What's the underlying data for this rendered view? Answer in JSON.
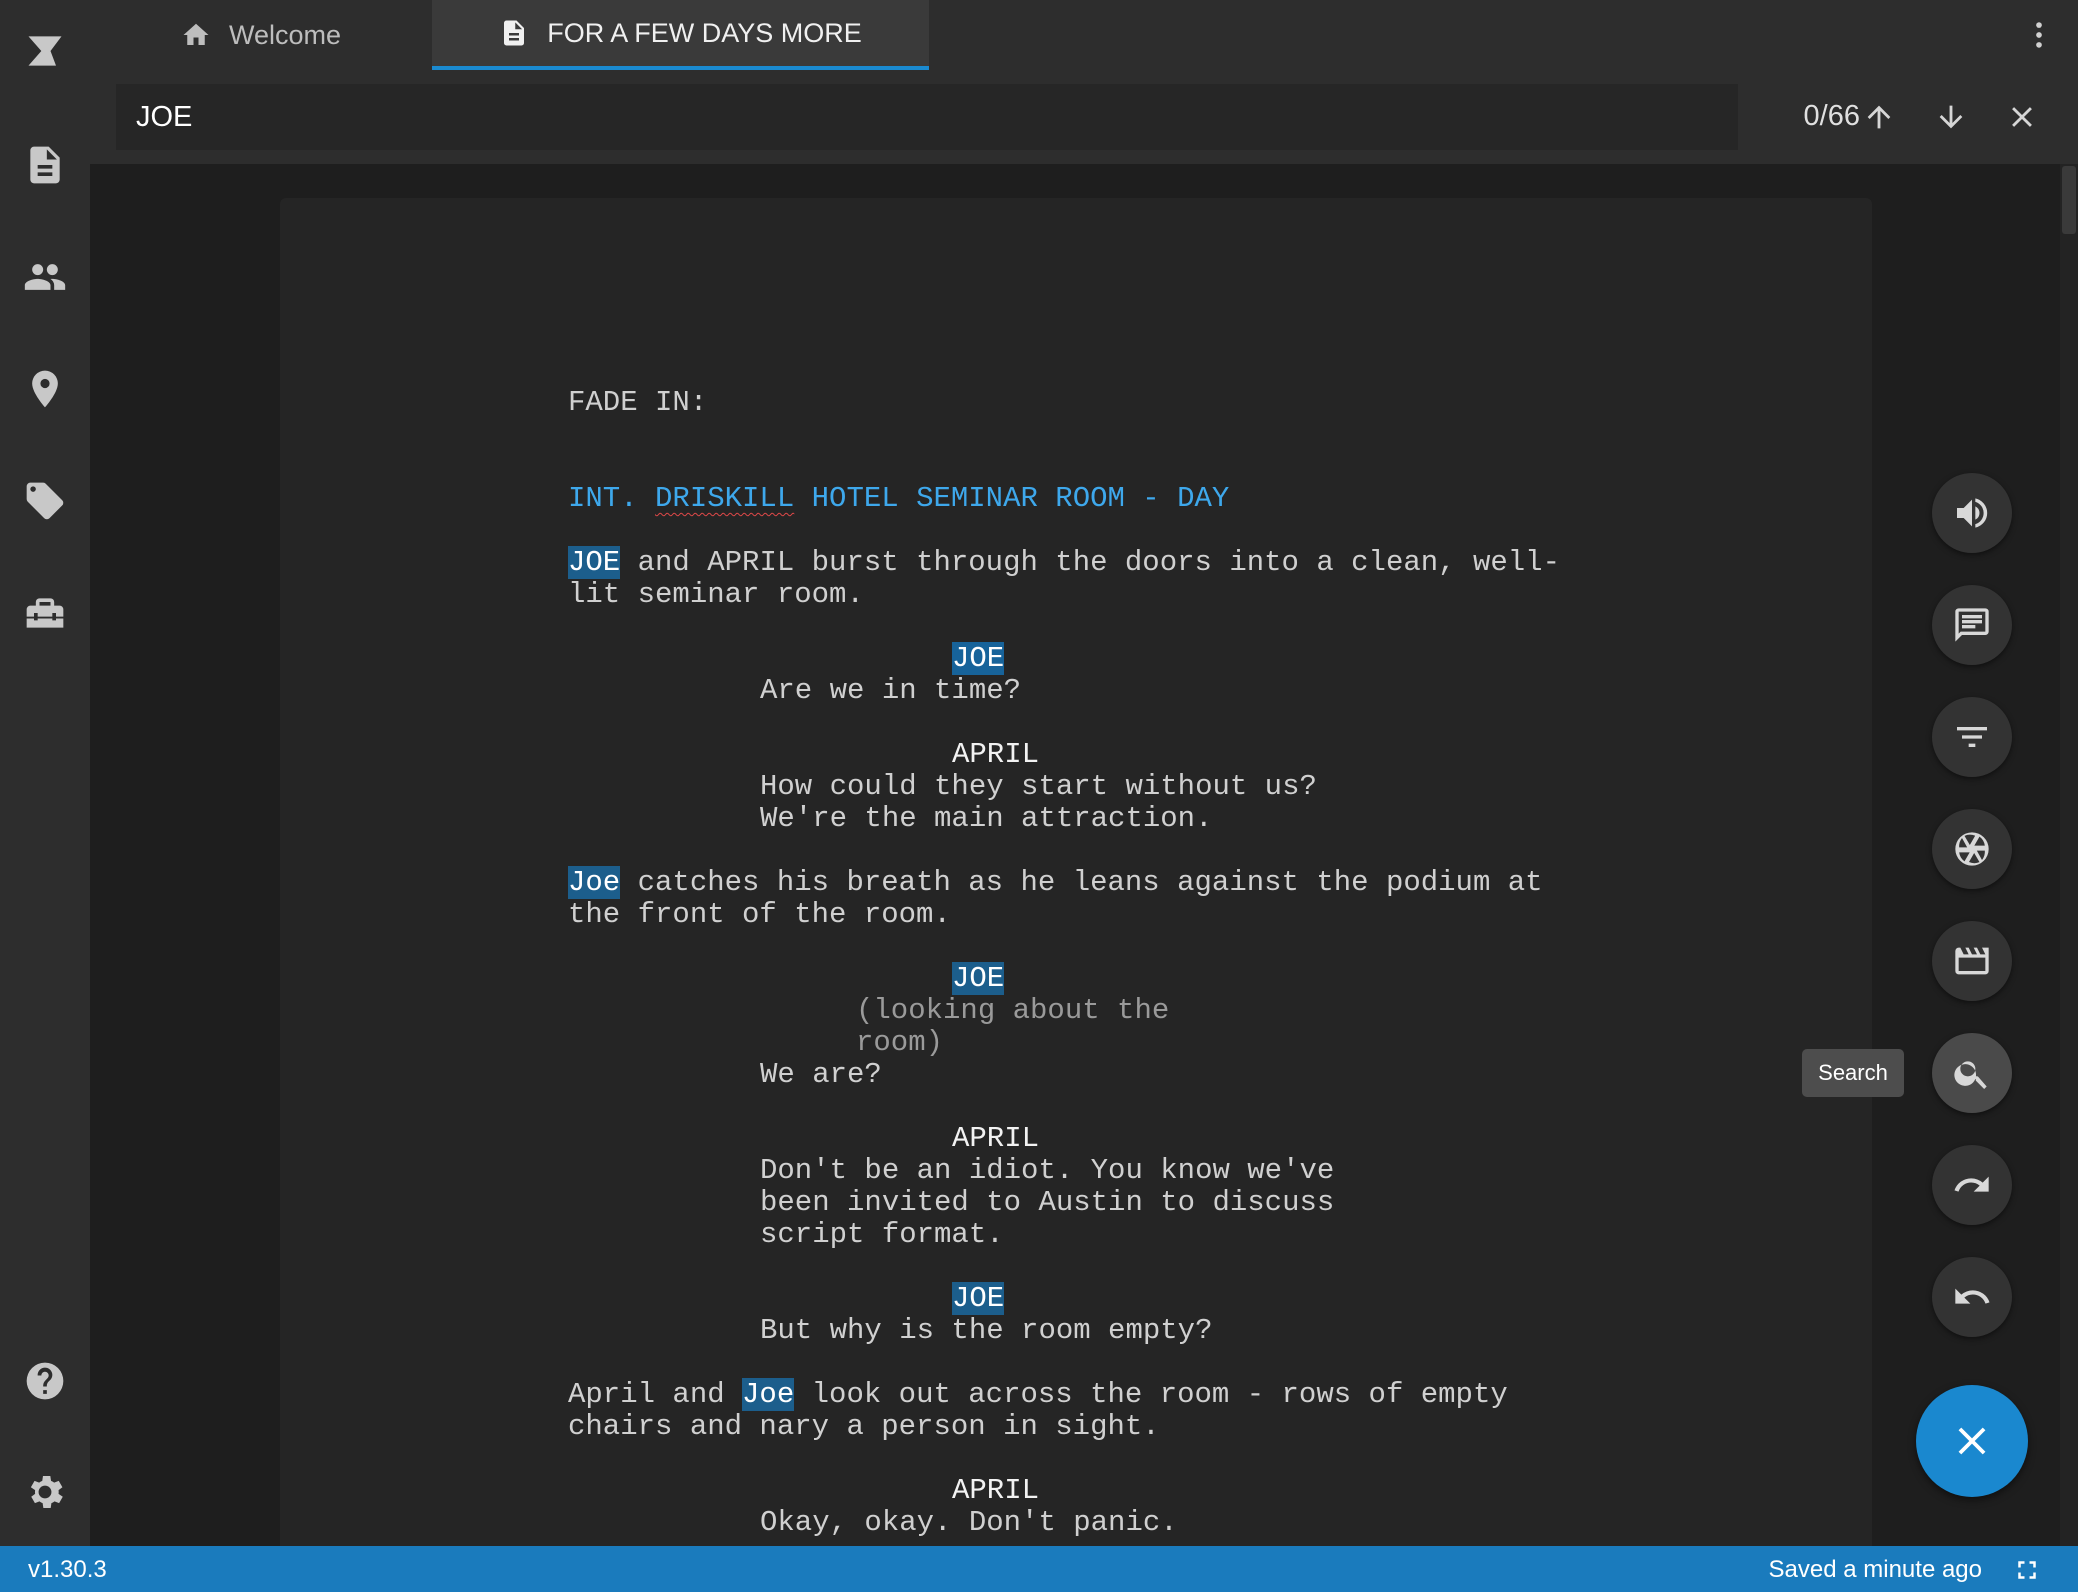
{
  "tabs": [
    {
      "label": "Welcome",
      "icon": "home-icon"
    },
    {
      "label": "FOR A FEW DAYS MORE",
      "icon": "document-icon",
      "active": true
    }
  ],
  "sidebar": {
    "items": [
      "logo-icon",
      "document-icon",
      "people-icon",
      "location-pin-icon",
      "tag-icon",
      "toolbox-icon"
    ],
    "bottom": [
      "help-icon",
      "gear-icon"
    ]
  },
  "search": {
    "value": "JOE",
    "count": "0/66"
  },
  "script": {
    "lines": [
      {
        "text": "FADE IN:"
      },
      {
        "seg": [
          "INT. ",
          "DRISKILL",
          " HOTEL SEMINAR ROOM - DAY"
        ]
      },
      {
        "seg": [
          "JOE",
          " and APRIL burst through the doors into a clean, well-"
        ]
      },
      {
        "text": "lit seminar room."
      },
      {
        "text": "JOE"
      },
      {
        "text": "Are we in time?"
      },
      {
        "text": "APRIL"
      },
      {
        "text": "How could they start without us?"
      },
      {
        "text": "We're the main attraction."
      },
      {
        "seg": [
          "Joe",
          " catches his breath as he leans against the podium at"
        ]
      },
      {
        "text": "the front of the room."
      },
      {
        "text": "JOE"
      },
      {
        "text": "(looking about the"
      },
      {
        "text": "room)"
      },
      {
        "text": "We are?"
      },
      {
        "text": "APRIL"
      },
      {
        "text": "Don't be an idiot. You know we've"
      },
      {
        "text": "been invited to Austin to discuss"
      },
      {
        "text": "script format."
      },
      {
        "text": "JOE"
      },
      {
        "text": "But why is the room empty?"
      },
      {
        "seg": [
          "April and ",
          "Joe",
          " look out across the room - rows of empty"
        ]
      },
      {
        "text": "chairs and nary a person in sight."
      },
      {
        "text": "APRIL"
      },
      {
        "text": "Okay, okay. Don't panic."
      }
    ]
  },
  "fabs": [
    "speaker-icon",
    "comment-icon",
    "filter-icon",
    "aperture-icon",
    "clapperboard-icon",
    "search-icon",
    "redo-icon",
    "undo-icon"
  ],
  "tooltip": "Search",
  "status": {
    "version": "v1.30.3",
    "saved": "Saved a minute ago"
  }
}
